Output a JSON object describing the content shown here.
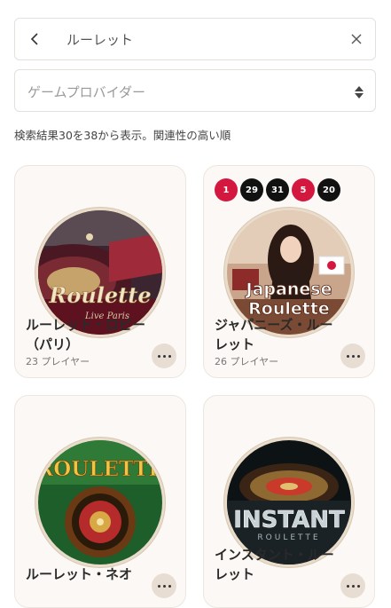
{
  "search": {
    "value": "ルーレット"
  },
  "provider_select": {
    "label": "ゲームプロバイダー"
  },
  "results_text": "検索結果30を38から表示。関連性の高い順",
  "colors": {
    "red": "#d3173f",
    "black": "#111111",
    "accent": "#e8ddd2"
  },
  "games": [
    {
      "name": "ルーレット・ロビー（パリ）",
      "players": "23 プレイヤー",
      "logo": "Roulette",
      "logo_sub": "Live Paris"
    },
    {
      "name": "ジャパニーズ・ルーレット",
      "players": "26 プレイヤー",
      "logo": "Japanese",
      "logo_line2": "Roulette",
      "recent_numbers": [
        {
          "value": "1",
          "color": "red"
        },
        {
          "value": "29",
          "color": "black"
        },
        {
          "value": "31",
          "color": "black"
        },
        {
          "value": "5",
          "color": "red"
        },
        {
          "value": "20",
          "color": "black"
        }
      ]
    },
    {
      "name": "ルーレット・ネオ",
      "logo": "ROULETTE"
    },
    {
      "name": "インスタント・ルーレット",
      "logo": "INSTANT",
      "logo_sub": "ROULETTE"
    }
  ]
}
